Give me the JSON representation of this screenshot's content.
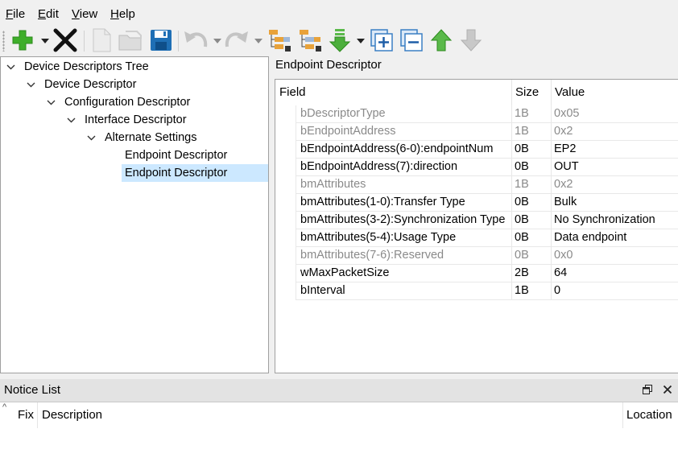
{
  "menu": [
    "File",
    "Edit",
    "View",
    "Help"
  ],
  "menu_mnemonics": [
    "F",
    "E",
    "V",
    "H"
  ],
  "tree": {
    "items": [
      {
        "label": "Device Descriptors Tree",
        "level": 0,
        "expanded": true
      },
      {
        "label": "Device Descriptor",
        "level": 1,
        "expanded": true
      },
      {
        "label": "Configuration Descriptor",
        "level": 2,
        "expanded": true
      },
      {
        "label": "Interface Descriptor",
        "level": 3,
        "expanded": true
      },
      {
        "label": "Alternate Settings",
        "level": 4,
        "expanded": true
      },
      {
        "label": "Endpoint Descriptor",
        "level": 5,
        "expanded": null
      },
      {
        "label": "Endpoint Descriptor",
        "level": 5,
        "expanded": null,
        "selected": true
      }
    ]
  },
  "detail": {
    "title": "Endpoint Descriptor",
    "columns": [
      "Field",
      "Size",
      "Value"
    ],
    "rows": [
      {
        "field": "bDescriptorType",
        "size": "1B",
        "value": "0x05",
        "dim": true
      },
      {
        "field": "bEndpointAddress",
        "size": "1B",
        "value": "0x2",
        "dim": true
      },
      {
        "field": "bEndpointAddress(6-0):endpointNum",
        "size": "0B",
        "value": "EP2",
        "dim": false
      },
      {
        "field": "bEndpointAddress(7):direction",
        "size": "0B",
        "value": "OUT",
        "dim": false
      },
      {
        "field": "bmAttributes",
        "size": "1B",
        "value": "0x2",
        "dim": true
      },
      {
        "field": "bmAttributes(1-0):Transfer Type",
        "size": "0B",
        "value": "Bulk",
        "dim": false
      },
      {
        "field": "bmAttributes(3-2):Synchronization Type",
        "size": "0B",
        "value": "No Synchronization",
        "dim": false
      },
      {
        "field": "bmAttributes(5-4):Usage Type",
        "size": "0B",
        "value": "Data endpoint",
        "dim": false
      },
      {
        "field": "bmAttributes(7-6):Reserved",
        "size": "0B",
        "value": "0x0",
        "dim": true
      },
      {
        "field": "wMaxPacketSize",
        "size": "2B",
        "value": "64",
        "dim": false
      },
      {
        "field": "bInterval",
        "size": "1B",
        "value": "0",
        "dim": false
      }
    ]
  },
  "notice": {
    "title": "Notice List",
    "columns": [
      "Fix",
      "Description",
      "Location"
    ],
    "float_icon": "restore-window-icon",
    "close_icon": "close-icon"
  },
  "toolbar_icons": [
    "add-icon",
    "delete-icon",
    "new-file-icon",
    "open-folder-icon",
    "save-icon",
    "undo-icon",
    "redo-icon",
    "collapse-tree-icon",
    "expand-tree-icon",
    "download-icon",
    "expand-all-icon",
    "collapse-all-icon",
    "move-up-icon",
    "move-down-icon"
  ],
  "colors": {
    "selection": "#cce8ff",
    "dim_text": "#8a8a8a",
    "green": "#3fae2a",
    "blue": "#1f6fb5"
  }
}
